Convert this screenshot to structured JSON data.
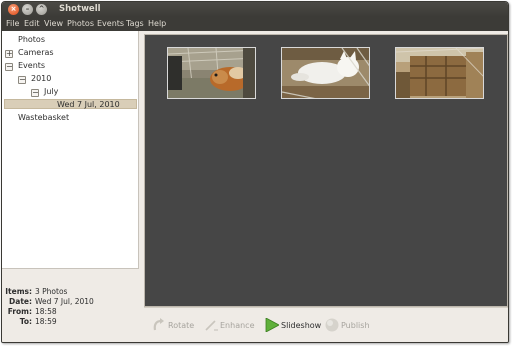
{
  "window": {
    "title": "Shotwell"
  },
  "menubar": [
    "File",
    "Edit",
    "View",
    "Photos",
    "Events",
    "Tags",
    "Help"
  ],
  "sidebar": {
    "photos": "Photos",
    "cameras": "Cameras",
    "events": "Events",
    "year": "2010",
    "month": "July",
    "selected_event": "Wed 7 Jul, 2010",
    "wastebasket": "Wastebasket",
    "collapsed_symbol": "+",
    "expanded_symbol": "−"
  },
  "info": {
    "items_label": "Items:",
    "items_value": "3 Photos",
    "date_label": "Date:",
    "date_value": "Wed 7 Jul, 2010",
    "from_label": "From:",
    "from_value": "18:58",
    "to_label": "To:",
    "to_value": "18:59"
  },
  "viewer": {
    "photo_count": 3,
    "background": "#464646",
    "photos": [
      {
        "subject": "guinea-pig-photo"
      },
      {
        "subject": "white-cat-photo"
      },
      {
        "subject": "wooden-crate-photo"
      }
    ]
  },
  "toolbar": {
    "rotate": "Rotate",
    "enhance": "Enhance",
    "slideshow": "Slideshow",
    "publish": "Publish"
  },
  "colors": {
    "titlebar": "#3c3b37",
    "close_button": "#dd4814",
    "selection": "#d9ceb8",
    "slideshow_icon": "#5fb03a"
  }
}
